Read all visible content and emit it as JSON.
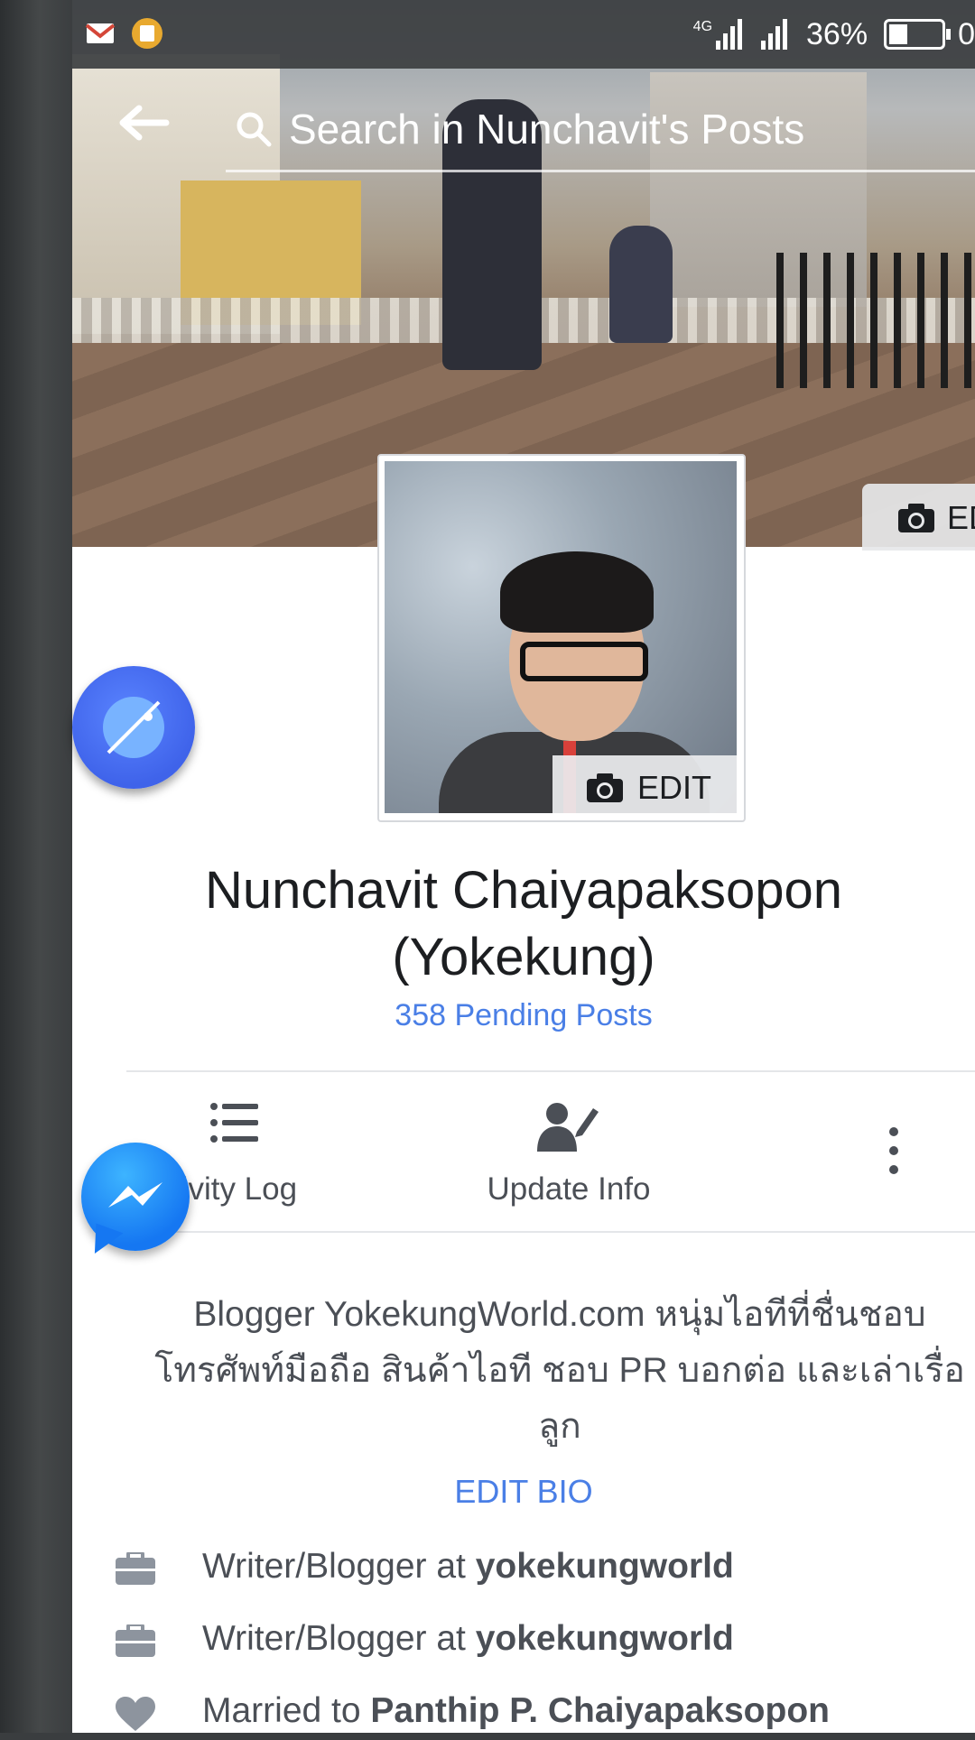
{
  "status_bar": {
    "network": "4G",
    "battery_percent": "36%",
    "time_partial": "0"
  },
  "search": {
    "placeholder": "Search in Nunchavit's Posts"
  },
  "cover": {
    "edit_label": "ED"
  },
  "profile": {
    "name_line1": "Nunchavit Chaiyapaksopon",
    "name_line2": "(Yokekung)",
    "pending_posts": "358 Pending Posts",
    "avatar_edit_label": "EDIT"
  },
  "actions": [
    {
      "label": "tivity Log",
      "icon": "list-icon"
    },
    {
      "label": "Update Info",
      "icon": "person-edit-icon"
    },
    {
      "label": "",
      "icon": "more-vertical-icon"
    }
  ],
  "bio": {
    "line1": "Blogger YokekungWorld.com หนุ่มไอทีที่ชื่นชอบ",
    "line2": "โทรศัพท์มือถือ สินค้าไอที ชอบ PR บอกต่อ และเล่าเรื่อ",
    "line3": "ลูก",
    "edit_label": "EDIT BIO"
  },
  "info": [
    {
      "prefix": "Writer/Blogger at ",
      "strong": "yokekungworld",
      "icon": "briefcase-icon"
    },
    {
      "prefix": "Writer/Blogger at ",
      "strong": "yokekungworld",
      "icon": "briefcase-icon"
    },
    {
      "prefix": "Married to ",
      "strong": "Panthip P. Chaiyapaksopon",
      "icon": "heart-icon"
    }
  ],
  "colors": {
    "link_blue": "#4a7fe6",
    "text_gray": "#4b4f56",
    "messenger_blue": "#1577f2",
    "chathead_blue": "#3f63ea"
  }
}
